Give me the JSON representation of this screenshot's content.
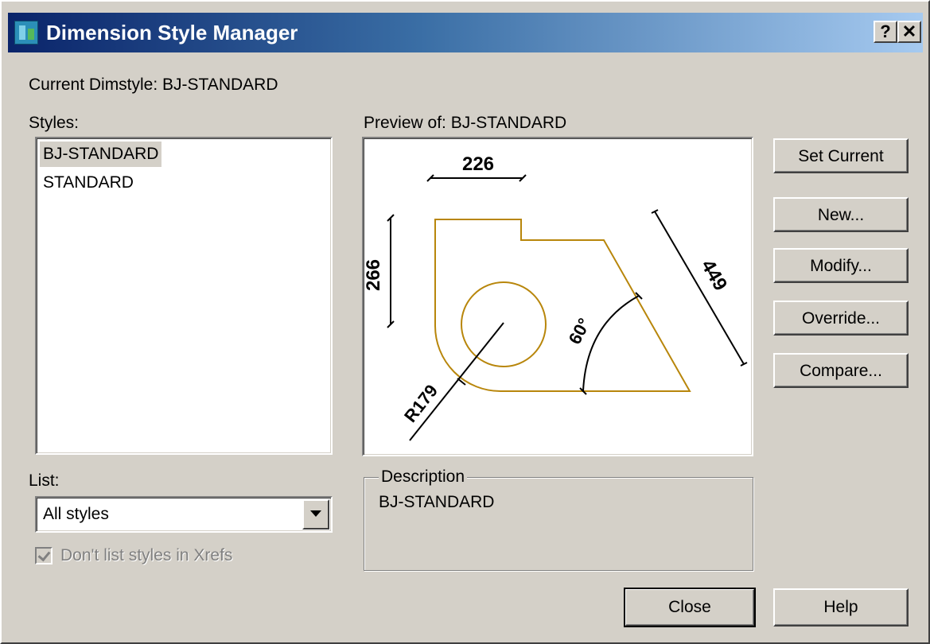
{
  "window": {
    "title": "Dimension Style Manager",
    "help_button": "?",
    "close_button": "✕"
  },
  "current_dimstyle": "Current Dimstyle: BJ-STANDARD",
  "styles": {
    "label": "Styles:",
    "items": [
      {
        "label": "BJ-STANDARD",
        "selected": true
      },
      {
        "label": "STANDARD",
        "selected": false
      }
    ]
  },
  "preview": {
    "label": "Preview of: BJ-STANDARD",
    "dimensions": {
      "horizontal": "226",
      "vertical": "266",
      "aligned": "449",
      "angular": "60°",
      "radius": "R179"
    },
    "colors": {
      "geometry": "#b8860b",
      "dimension": "#000000",
      "background": "#ffffff"
    }
  },
  "buttons": {
    "set_current": "Set Current",
    "new": "New...",
    "modify": "Modify...",
    "override": "Override...",
    "compare": "Compare...",
    "close": "Close",
    "help": "Help"
  },
  "list": {
    "label": "List:",
    "selected": "All styles"
  },
  "xrefs_checkbox": {
    "label": "Don't list styles in Xrefs",
    "checked": true,
    "disabled": true
  },
  "description": {
    "legend": "Description",
    "text": "BJ-STANDARD"
  }
}
